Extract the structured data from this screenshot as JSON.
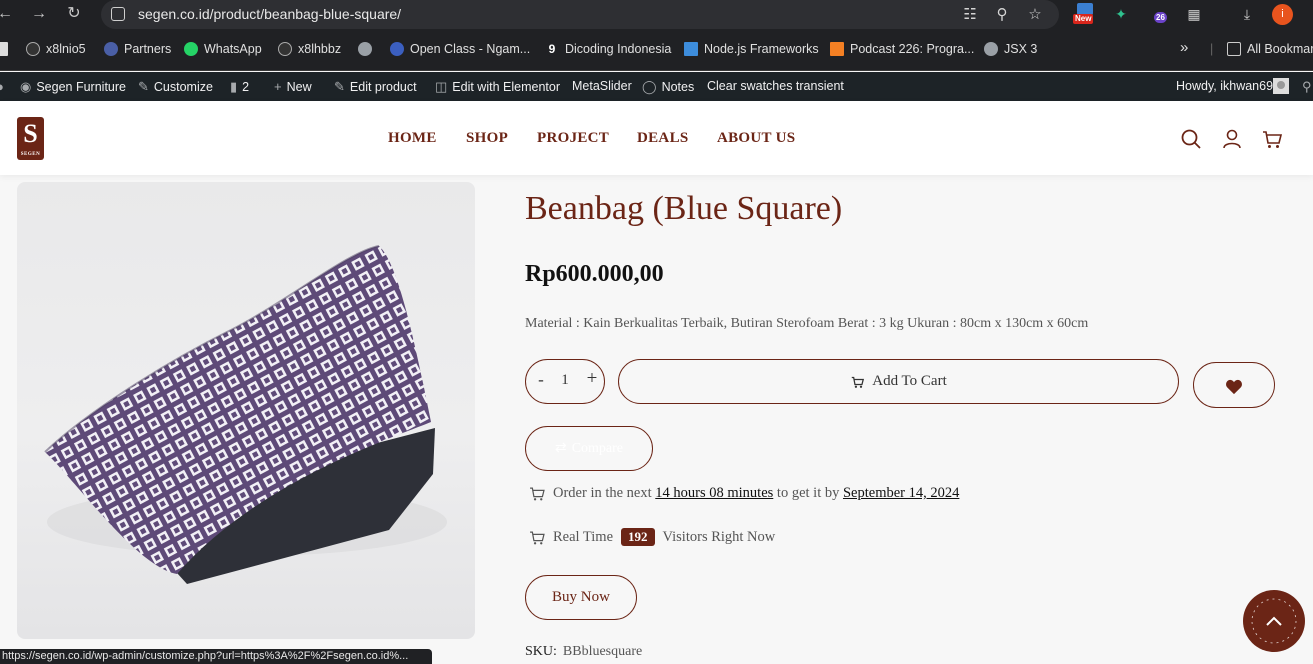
{
  "browser": {
    "url": "segen.co.id/product/beanbag-blue-square/",
    "new_badge": "New",
    "ext_badge": "26",
    "profile_initial": "i",
    "bookmarks": [
      {
        "label": "x8lnio5"
      },
      {
        "label": "Partners"
      },
      {
        "label": "WhatsApp"
      },
      {
        "label": "x8lhbbz"
      },
      {
        "label": ""
      },
      {
        "label": "Open Class - Ngam..."
      },
      {
        "label": "Dicoding Indonesia"
      },
      {
        "label": "Node.js Frameworks"
      },
      {
        "label": "Podcast 226: Progra..."
      },
      {
        "label": "JSX 3"
      }
    ],
    "more_label": "»",
    "all_bookmarks": "All Bookmarks"
  },
  "adminbar": {
    "site": "Segen Furniture",
    "customize": "Customize",
    "comments": "2",
    "new": "New",
    "edit_product": "Edit product",
    "elementor": "Edit with Elementor",
    "metaslider": "MetaSlider",
    "notes": "Notes",
    "clear": "Clear swatches transient",
    "howdy": "Howdy, ikhwan69"
  },
  "header": {
    "logo_letter": "S",
    "logo_text": "SEGEN",
    "menu": [
      "HOME",
      "SHOP",
      "PROJECT",
      "DEALS",
      "ABOUT US"
    ]
  },
  "product": {
    "title": "Beanbag (Blue Square)",
    "price": "Rp600.000,00",
    "description": "Material : Kain Berkualitas Terbaik, Butiran Sterofoam Berat : 3 kg Ukuran : 80cm x 130cm x 60cm",
    "qty_minus": "-",
    "quantity": "1",
    "qty_plus": "+",
    "add_to_cart": "Add To Cart",
    "compare": "Compare",
    "order_prefix": "Order in the next",
    "order_time": "14 hours 08 minutes",
    "order_mid": "to get it by",
    "order_date": "September 14, 2024",
    "realtime_prefix": "Real Time",
    "visitors": "192",
    "realtime_suffix": "Visitors Right Now",
    "buy_now": "Buy Now",
    "sku_label": "SKU:",
    "sku_value": "BBbluesquare"
  },
  "status_bar": "https://segen.co.id/wp-admin/customize.php?url=https%3A%2F%2Fsegen.co.id%..."
}
